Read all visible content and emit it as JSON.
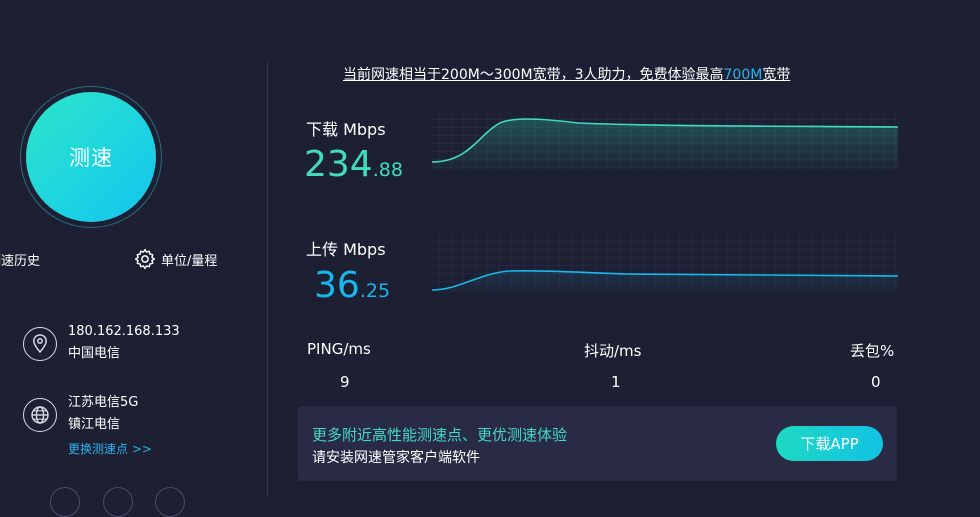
{
  "left": {
    "speed_button": "测速",
    "history_link": "测速历史",
    "unit_link": "单位/量程",
    "ip": {
      "address": "180.162.168.133",
      "isp": "中国电信"
    },
    "server": {
      "name": "江苏电信5G",
      "isp": "镇江电信",
      "switch_label": "更换测速点 >>"
    }
  },
  "main": {
    "headline": {
      "prefix": "当前网速相当于200M～300M宽带，3人助力，免费体验最高",
      "highlight": "700M",
      "suffix": "宽带"
    },
    "download": {
      "label": "下载 Mbps",
      "int": "234",
      "dec": ".88"
    },
    "upload": {
      "label": "上传 Mbps",
      "int": "36",
      "dec": ".25"
    },
    "stats": [
      {
        "label": "PING/ms",
        "value": "9"
      },
      {
        "label": "抖动/ms",
        "value": "1"
      },
      {
        "label": "丢包%",
        "value": "0"
      }
    ],
    "promo": {
      "line1": "更多附近高性能测速点、更优测速体验",
      "line2": "请安装网速管家客户端软件",
      "button": "下载APP"
    }
  },
  "colors": {
    "background": "#1d2033",
    "download_accent": "#40dcc0",
    "upload_accent": "#18b8ee",
    "link": "#2ab2f0"
  }
}
